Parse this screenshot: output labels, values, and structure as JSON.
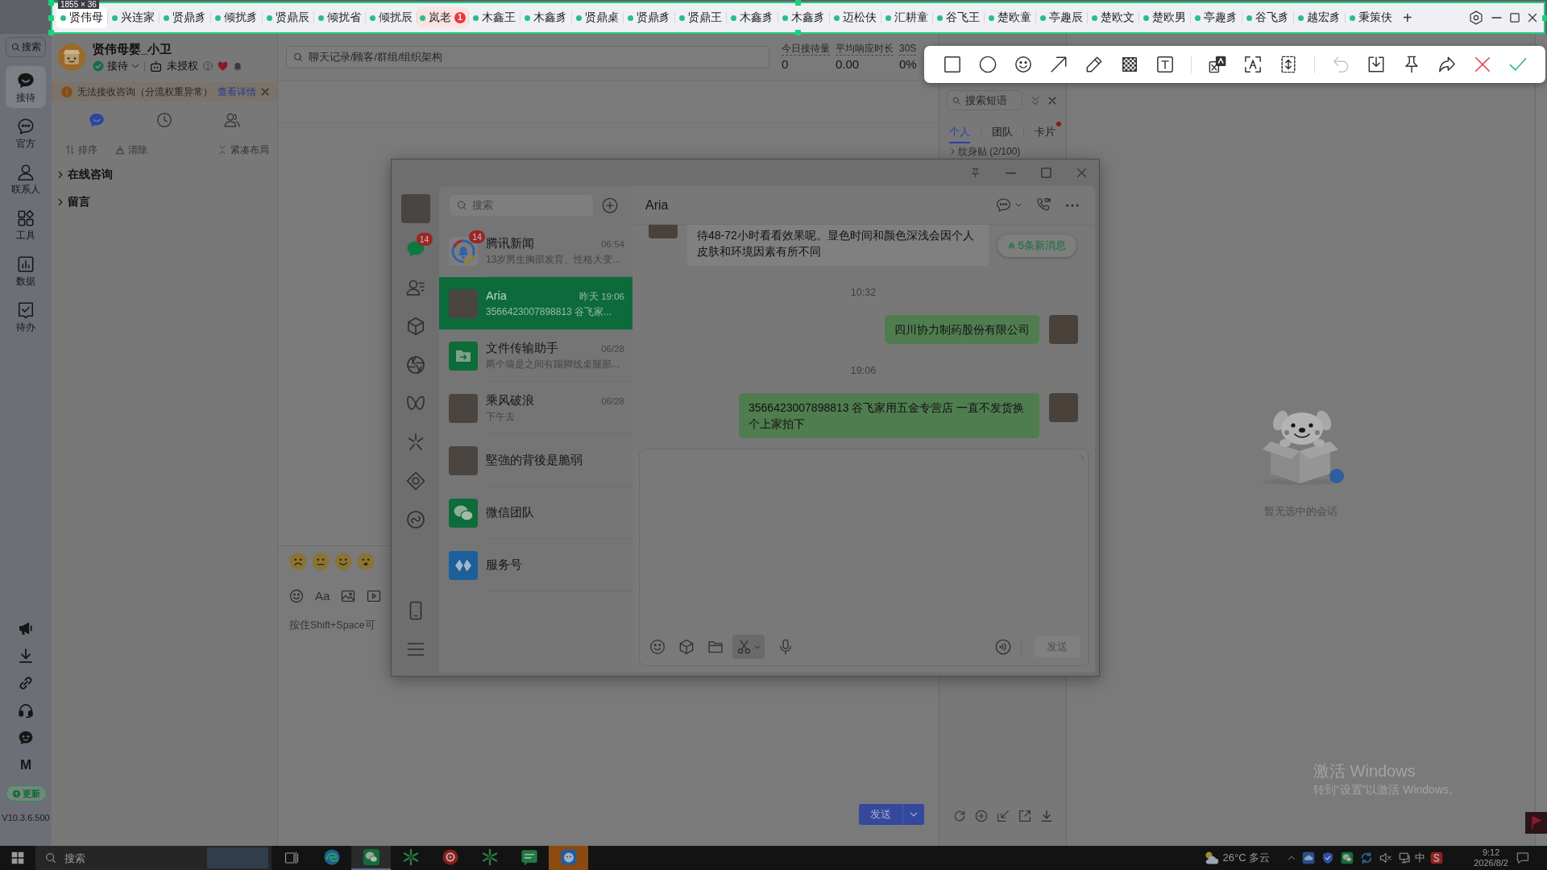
{
  "capture_overlay": {
    "size_label": "1855 × 36"
  },
  "top_tabs": {
    "items": [
      {
        "label": "贤伟母",
        "selected": true
      },
      {
        "label": "兴连家",
        "selected": false
      },
      {
        "label": "贤鼎豸",
        "selected": false
      },
      {
        "label": "倾扰豸",
        "selected": false
      },
      {
        "label": "贤鼎辰",
        "selected": false
      },
      {
        "label": "倾扰省",
        "selected": false
      },
      {
        "label": "倾扰辰",
        "selected": false
      },
      {
        "label": "岚老",
        "selected": false,
        "badge": "1"
      },
      {
        "label": "木鑫王",
        "selected": false
      },
      {
        "label": "木鑫豸",
        "selected": false
      },
      {
        "label": "贤鼎桌",
        "selected": false
      },
      {
        "label": "贤鼎豸",
        "selected": false
      },
      {
        "label": "贤鼎王",
        "selected": false
      },
      {
        "label": "木鑫豸",
        "selected": false
      },
      {
        "label": "木鑫豸",
        "selected": false
      },
      {
        "label": "迈松伕",
        "selected": false
      },
      {
        "label": "汇耕童",
        "selected": false
      },
      {
        "label": "谷飞王",
        "selected": false
      },
      {
        "label": "楚欧童",
        "selected": false
      },
      {
        "label": "亭趣辰",
        "selected": false
      },
      {
        "label": "楚欧文",
        "selected": false
      },
      {
        "label": "楚欧男",
        "selected": false
      },
      {
        "label": "亭趣豸",
        "selected": false
      },
      {
        "label": "谷飞豸",
        "selected": false
      },
      {
        "label": "越宏豸",
        "selected": false
      },
      {
        "label": "秉策伕",
        "selected": false
      }
    ],
    "add_label": "+"
  },
  "annotation_toolbar": {
    "tool_groups": [
      {
        "tools": [
          {
            "kind": "rectangle",
            "disabled": false
          },
          {
            "kind": "ellipse",
            "disabled": false
          },
          {
            "kind": "emoji",
            "disabled": false
          },
          {
            "kind": "arrow",
            "disabled": false
          },
          {
            "kind": "pencil",
            "disabled": false
          },
          {
            "kind": "mosaic",
            "disabled": false
          },
          {
            "kind": "text",
            "disabled": false
          }
        ]
      },
      {
        "tools": [
          {
            "kind": "translate",
            "disabled": false
          },
          {
            "kind": "ocr",
            "disabled": false
          },
          {
            "kind": "scroll_capture",
            "disabled": false
          }
        ]
      },
      {
        "tools": [
          {
            "kind": "undo",
            "disabled": true
          },
          {
            "kind": "save",
            "disabled": false
          },
          {
            "kind": "pin",
            "disabled": false
          },
          {
            "kind": "share",
            "disabled": false
          },
          {
            "kind": "cancel",
            "disabled": false
          },
          {
            "kind": "confirm",
            "disabled": false
          }
        ]
      }
    ]
  },
  "nav_rail": {
    "search_label": "搜索",
    "items": [
      {
        "kind": "reception",
        "label": "接待",
        "selected": true
      },
      {
        "kind": "official",
        "label": "官方",
        "selected": false
      },
      {
        "kind": "contacts",
        "label": "联系人",
        "selected": false
      },
      {
        "kind": "tools",
        "label": "工具",
        "selected": false
      },
      {
        "kind": "data",
        "label": "数据",
        "selected": false
      },
      {
        "kind": "todo",
        "label": "待办",
        "selected": false
      }
    ],
    "brand_letter": "M",
    "update_label": "更新",
    "version": "V10.3.6.500"
  },
  "agent": {
    "name": "贤伟母婴_小卫",
    "status": "接待",
    "online": true,
    "authorization": "未授权"
  },
  "alert_bar": {
    "message": "无法接收咨询（分流权重异常）",
    "link": "查看详情"
  },
  "session_tabs": [
    {
      "kind": "chats",
      "selected": true
    },
    {
      "kind": "history",
      "selected": false
    },
    {
      "kind": "colleagues",
      "selected": false
    }
  ],
  "session_actions": [
    {
      "kind": "sort",
      "label": "排序"
    },
    {
      "kind": "clear",
      "label": "清除"
    },
    {
      "kind": "compact",
      "label": "紧凑布局"
    }
  ],
  "session_groups": [
    {
      "label": "在线咨询",
      "expanded": false
    },
    {
      "label": "留言",
      "expanded": false
    }
  ],
  "workspace": {
    "search_placeholder": "聊天记录/顾客/群组/组织架构",
    "stats": [
      {
        "label": "今日接待量",
        "value": "0"
      },
      {
        "label": "平均响应时长",
        "value": "0.00"
      },
      {
        "label": "30S",
        "value": "0%"
      }
    ],
    "composer": {
      "format_label": "Aa",
      "placeholder": "按住Shift+Space可",
      "send_label": "发送"
    }
  },
  "quick_replies": {
    "search_placeholder": "搜索短语",
    "tabs": [
      {
        "label": "个人",
        "selected": true,
        "dot": false
      },
      {
        "label": "团队",
        "selected": false,
        "dot": false
      },
      {
        "label": "卡片",
        "selected": false,
        "dot": true
      }
    ],
    "folders": [
      {
        "label": "纹身贴 (2/100)",
        "expanded": false
      }
    ]
  },
  "empty_state": {
    "text": "暂无选中的会话"
  },
  "windows_activation": {
    "title": "激活 Windows",
    "subtitle": "转到“设置”以激活 Windows。"
  },
  "wechat": {
    "nav": [
      {
        "kind": "chats",
        "selected": true,
        "badge": "14"
      },
      {
        "kind": "contacts",
        "selected": false
      },
      {
        "kind": "favorites",
        "selected": false
      },
      {
        "kind": "moments",
        "selected": false
      },
      {
        "kind": "channels",
        "selected": false
      },
      {
        "kind": "search",
        "selected": false
      },
      {
        "kind": "mini_programs",
        "selected": false
      },
      {
        "kind": "apps",
        "selected": false
      }
    ],
    "search_placeholder": "搜索",
    "chats": [
      {
        "kind": "news",
        "name": "腾讯新闻",
        "time": "06:54",
        "preview": "13岁男生胸部发育、性格大变...",
        "badge": "14",
        "selected": false
      },
      {
        "kind": "photo",
        "name": "Aria",
        "time": "昨天 19:06",
        "preview": "3566423007898813 谷飞家...",
        "selected": true
      },
      {
        "kind": "file_transfer",
        "name": "文件传输助手",
        "time": "06/28",
        "preview": "两个墙是之间有踢脚线桌腿那...",
        "selected": false
      },
      {
        "kind": "photo",
        "name": "乘风破浪",
        "time": "06/28",
        "preview": "下午去",
        "selected": false
      },
      {
        "kind": "photo",
        "name": "堅強的背後是脆弱",
        "selected": false
      },
      {
        "kind": "wechat_team",
        "name": "微信团队",
        "selected": false
      },
      {
        "kind": "service",
        "name": "服务号",
        "selected": false
      }
    ],
    "conversation": {
      "title": "Aria",
      "new_messages_label": "5条新消息",
      "messages": [
        {
          "kind": "incoming",
          "text": "待48-72小时看看效果呢。显色时间和颜色深浅会因个人皮肤和环境因素有所不同"
        },
        {
          "kind": "time",
          "text": "10:32"
        },
        {
          "kind": "outgoing",
          "text": "四川协力制药股份有限公司"
        },
        {
          "kind": "time",
          "text": "19:06"
        },
        {
          "kind": "outgoing",
          "text": "3566423007898813 谷飞家用五金专营店 一直不发货换个上家拍下"
        }
      ],
      "send_label": "发送",
      "send_disabled": true
    }
  },
  "taskbar": {
    "search_placeholder": "搜索",
    "apps": [
      {
        "kind": "browser",
        "focused": false,
        "flashing": false
      },
      {
        "kind": "wechat",
        "focused": true,
        "flashing": false
      },
      {
        "kind": "star",
        "focused": false,
        "flashing": false
      },
      {
        "kind": "ring",
        "focused": false,
        "flashing": false
      },
      {
        "kind": "star",
        "focused": false,
        "flashing": false
      },
      {
        "kind": "message",
        "focused": false,
        "flashing": false
      },
      {
        "kind": "face",
        "focused": false,
        "flashing": true
      }
    ],
    "weather": "26°C 多云",
    "ime": "中",
    "time": "9:12",
    "date": "2026/8/2"
  }
}
